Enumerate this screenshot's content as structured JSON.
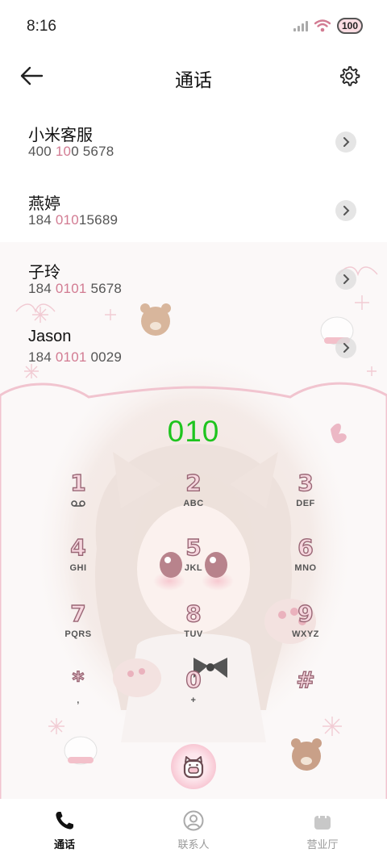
{
  "status_bar": {
    "time": "8:16",
    "battery": "100"
  },
  "header": {
    "title": "通话"
  },
  "suggestions": [
    {
      "name": "小米客服",
      "num_pre": "400 ",
      "num_hl": "10",
      "num_post": "0 5678"
    },
    {
      "name": "燕婷",
      "num_pre": "184 ",
      "num_hl": "010",
      "num_post": "15689"
    },
    {
      "name": "子玲",
      "num_pre": "184 ",
      "num_hl": "0101",
      "num_post": " 5678"
    },
    {
      "name": "Jason",
      "num_pre": "184 ",
      "num_hl": "0101",
      "num_post": " 0029"
    }
  ],
  "dialer": {
    "input": "010",
    "keys": [
      {
        "digit": "1",
        "letters": ""
      },
      {
        "digit": "2",
        "letters": "ABC"
      },
      {
        "digit": "3",
        "letters": "DEF"
      },
      {
        "digit": "4",
        "letters": "GHI"
      },
      {
        "digit": "5",
        "letters": "JKL"
      },
      {
        "digit": "6",
        "letters": "MNO"
      },
      {
        "digit": "7",
        "letters": "PQRS"
      },
      {
        "digit": "8",
        "letters": "TUV"
      },
      {
        "digit": "9",
        "letters": "WXYZ"
      },
      {
        "digit": "*",
        "letters": ","
      },
      {
        "digit": "0",
        "letters": "+"
      },
      {
        "digit": "#",
        "letters": ""
      }
    ]
  },
  "bottom_nav": [
    {
      "label": "通话",
      "icon": "phone-icon",
      "active": true
    },
    {
      "label": "联系人",
      "icon": "person-icon",
      "active": false
    },
    {
      "label": "营业厅",
      "icon": "shopping-bag-icon",
      "active": false
    }
  ],
  "colors": {
    "dial_text": "#1ec41e",
    "highlight": "#d27b92",
    "key_fill": "#f6d6de",
    "key_stroke": "#9a6776"
  }
}
